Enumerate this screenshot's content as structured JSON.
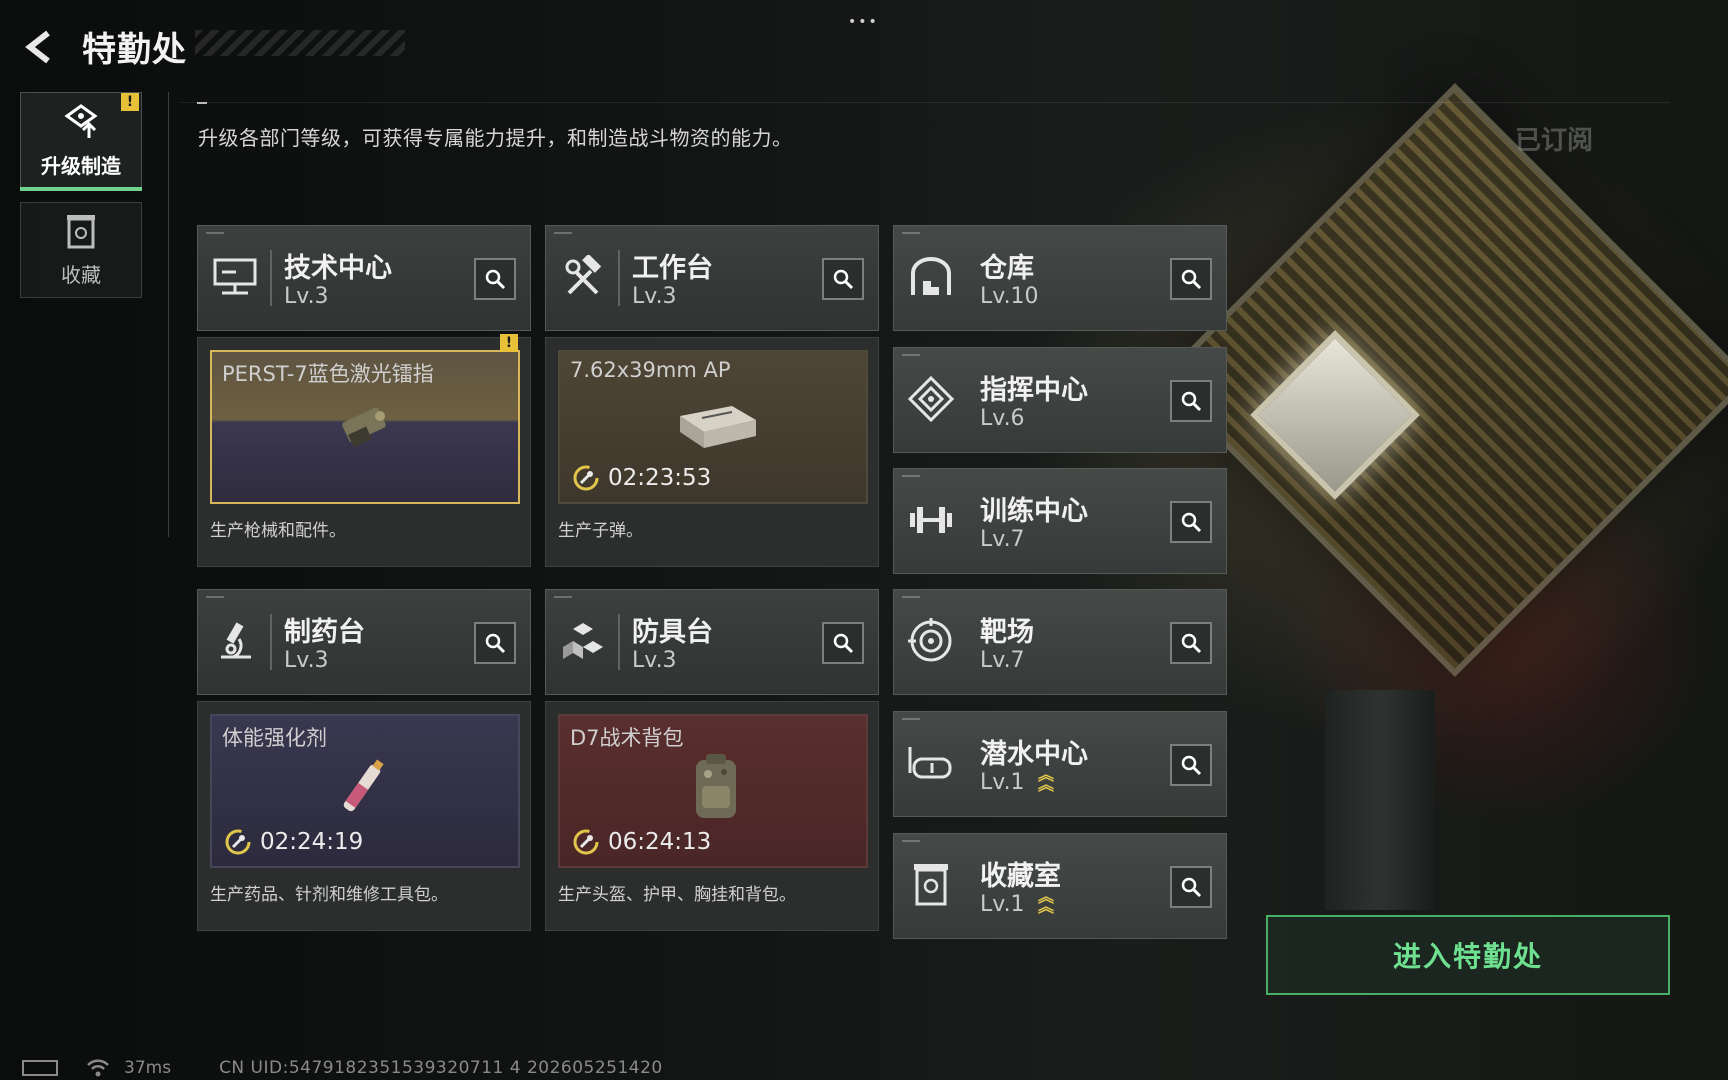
{
  "header": {
    "title": "特勤处",
    "more_dots": "•••"
  },
  "nav": [
    {
      "label": "升级制造",
      "active": true,
      "badge": "!"
    },
    {
      "label": "收藏",
      "active": false
    }
  ],
  "description": "升级各部门等级，可获得专属能力提升，和制造战斗物资的能力。",
  "subscribed_label": "已订阅",
  "facilities_left": [
    {
      "name": "技术中心",
      "level": "Lv.3",
      "icon": "monitor-icon",
      "production": {
        "item": "PERST-7蓝色激光镭指",
        "timer": "",
        "rarity_color": "#d9b65a",
        "badge": "!",
        "desc": "生产枪械和配件。"
      }
    },
    {
      "name": "工作台",
      "level": "Lv.3",
      "icon": "hammer-wrench-icon",
      "production": {
        "item": "7.62x39mm AP",
        "timer": "02:23:53",
        "rarity_color": "#4f4a3a",
        "desc": "生产子弹。"
      }
    },
    {
      "name": "制药台",
      "level": "Lv.3",
      "icon": "microscope-icon",
      "production": {
        "item": "体能强化剂",
        "timer": "02:24:19",
        "rarity_color": "#48465b",
        "desc": "生产药品、针剂和维修工具包。"
      }
    },
    {
      "name": "防具台",
      "level": "Lv.3",
      "icon": "armor-blocks-icon",
      "production": {
        "item": "D7战术背包",
        "timer": "06:24:13",
        "rarity_color": "#5a3a3a",
        "desc": "生产头盔、护甲、胸挂和背包。"
      }
    }
  ],
  "facilities_right": [
    {
      "name": "仓库",
      "level": "Lv.10",
      "icon": "warehouse-icon",
      "upgradable": false
    },
    {
      "name": "指挥中心",
      "level": "Lv.6",
      "icon": "command-icon",
      "upgradable": false
    },
    {
      "name": "训练中心",
      "level": "Lv.7",
      "icon": "dumbbell-icon",
      "upgradable": false
    },
    {
      "name": "靶场",
      "level": "Lv.7",
      "icon": "target-icon",
      "upgradable": false
    },
    {
      "name": "潜水中心",
      "level": "Lv.1",
      "icon": "diving-mask-icon",
      "upgradable": true
    },
    {
      "name": "收藏室",
      "level": "Lv.1",
      "icon": "collection-icon",
      "upgradable": true
    }
  ],
  "enter_button": "进入特勤处",
  "footer": {
    "ping": "37ms",
    "uid": "CN UID:5479182351539320711 4 202605251420"
  },
  "colors": {
    "accent_green": "#6fe08f",
    "warning_yellow": "#e7c238"
  }
}
